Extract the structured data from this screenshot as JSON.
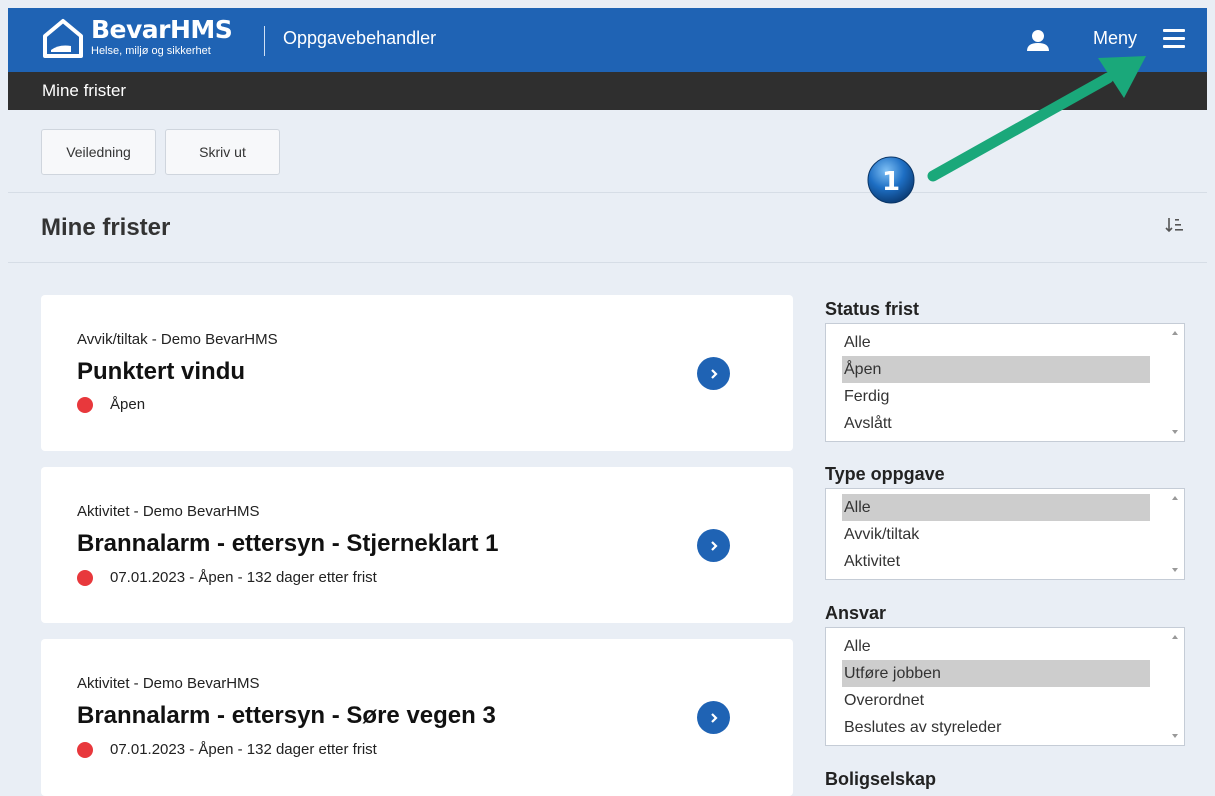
{
  "header": {
    "brand_name": "BevarHMS",
    "brand_tagline": "Helse, miljø og sikkerhet",
    "app_title": "Oppgavebehandler",
    "menu_label": "Meny",
    "user_icon": "user-icon",
    "menu_icon": "hamburger-icon",
    "brand_color": "#1f63b4"
  },
  "subheader": {
    "title": "Mine frister"
  },
  "toolbar": {
    "guide_label": "Veiledning",
    "print_label": "Skriv ut"
  },
  "section": {
    "title": "Mine frister",
    "sort_icon": "sort-icon"
  },
  "cards": [
    {
      "category": "Avvik/tiltak - Demo BevarHMS",
      "title": "Punktert vindu",
      "status": "Åpen"
    },
    {
      "category": "Aktivitet - Demo BevarHMS",
      "title": "Brannalarm - ettersyn - Stjerneklart 1",
      "status": "07.01.2023 - Åpen - 132 dager etter frist"
    },
    {
      "category": "Aktivitet - Demo BevarHMS",
      "title": "Brannalarm - ettersyn - Søre vegen 3",
      "status": "07.01.2023 - Åpen - 132 dager etter frist"
    }
  ],
  "filters": {
    "status": {
      "label": "Status frist",
      "options": [
        "Alle",
        "Åpen",
        "Ferdig",
        "Avslått"
      ],
      "selected": "Åpen"
    },
    "type": {
      "label": "Type oppgave",
      "options": [
        "Alle",
        "Avvik/tiltak",
        "Aktivitet"
      ],
      "selected": "Alle"
    },
    "ansvar": {
      "label": "Ansvar",
      "options": [
        "Alle",
        "Utføre jobben",
        "Overordnet",
        "Beslutes av styreleder"
      ],
      "selected": "Utføre jobben"
    },
    "boligselskap": {
      "label": "Boligselskap"
    }
  },
  "annotation": {
    "marker": "1",
    "arrow_color": "#1aa87a"
  },
  "colors": {
    "status_open": "#e8383c",
    "accent": "#1f63b4"
  }
}
